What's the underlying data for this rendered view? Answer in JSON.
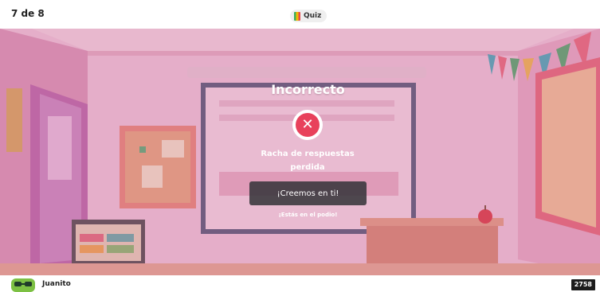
{
  "header": {
    "question_counter": "7 de 8",
    "mode_label": "Quiz",
    "mode_icon": "quiz-icon"
  },
  "result": {
    "title": "Incorrecto",
    "icon": "wrong-x-icon",
    "streak_lines": [
      "Racha de respuestas",
      "perdida"
    ],
    "cheer_button": "¡Creemos en ti!",
    "podium_note": "¡Estás en el podio!"
  },
  "footer": {
    "player_name": "Juanito",
    "score": "2758"
  },
  "colors": {
    "wrong": "#e8415b",
    "overlay": "#d282aa",
    "score_bg": "#1c1c1c"
  }
}
